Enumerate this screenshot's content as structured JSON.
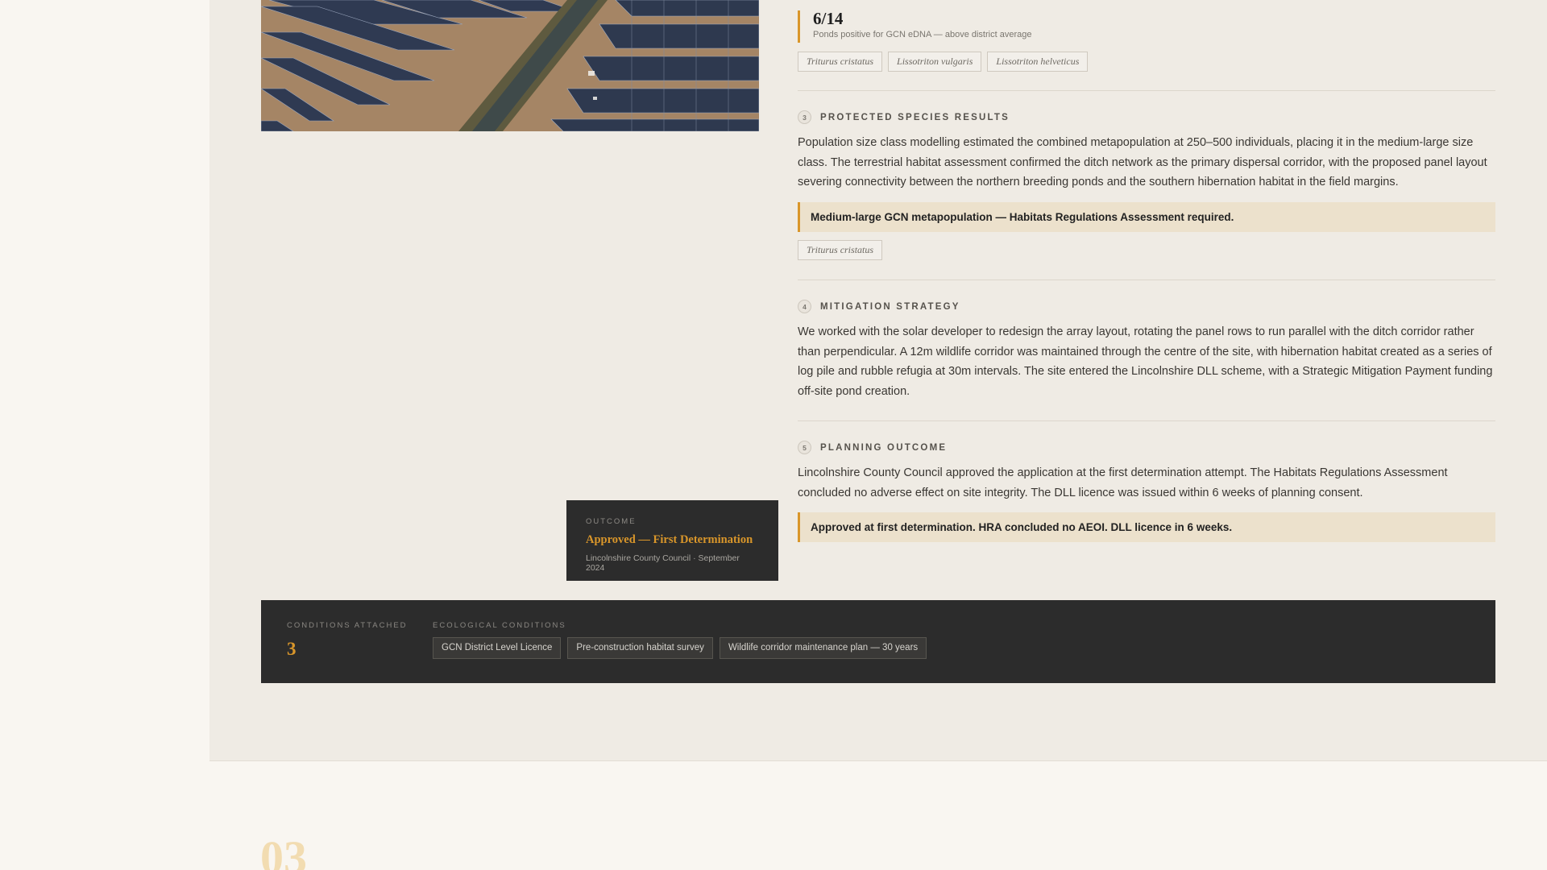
{
  "stat": {
    "value": "6/14",
    "label": "Ponds positive for GCN eDNA — above district average"
  },
  "species_tags_top": [
    "Triturus cristatus",
    "Lissotriton vulgaris",
    "Lissotriton helveticus"
  ],
  "sections": [
    {
      "number": "3",
      "title": "PROTECTED SPECIES RESULTS",
      "body": "Population size class modelling estimated the combined metapopulation at 250–500 individuals, placing it in the medium-large size class. The terrestrial habitat assessment confirmed the ditch network as the primary dispersal corridor, with the proposed panel layout severing connectivity between the northern breeding ponds and the southern hibernation habitat in the field margins.",
      "callout": "Medium-large GCN metapopulation — Habitats Regulations Assessment required.",
      "tags": [
        "Triturus cristatus"
      ]
    },
    {
      "number": "4",
      "title": "MITIGATION STRATEGY",
      "body": "We worked with the solar developer to redesign the array layout, rotating the panel rows to run parallel with the ditch corridor rather than perpendicular. A 12m wildlife corridor was maintained through the centre of the site, with hibernation habitat created as a series of log pile and rubble refugia at 30m intervals. The site entered the Lincolnshire DLL scheme, with a Strategic Mitigation Payment funding off-site pond creation."
    },
    {
      "number": "5",
      "title": "PLANNING OUTCOME",
      "body": "Lincolnshire County Council approved the application at the first determination attempt. The Habitats Regulations Assessment concluded no adverse effect on site integrity. The DLL licence was issued within 6 weeks of planning consent.",
      "callout": "Approved at first determination. HRA concluded no AEOI. DLL licence in 6 weeks."
    }
  ],
  "outcome": {
    "eyebrow": "OUTCOME",
    "title": "Approved — First Determination",
    "meta": "Lincolnshire County Council · September 2024"
  },
  "conditions": {
    "count_label": "CONDITIONS ATTACHED",
    "count": "3",
    "eco_label": "ECOLOGICAL CONDITIONS",
    "tags": [
      "GCN District Level Licence",
      "Pre-construction habitat survey",
      "Wildlife corridor maintenance plan — 30 years"
    ]
  },
  "next_section_number": "03",
  "colors": {
    "accent": "#d9962a",
    "dark_panel": "#2c2c2c",
    "callout_bg": "#ece1cc"
  }
}
